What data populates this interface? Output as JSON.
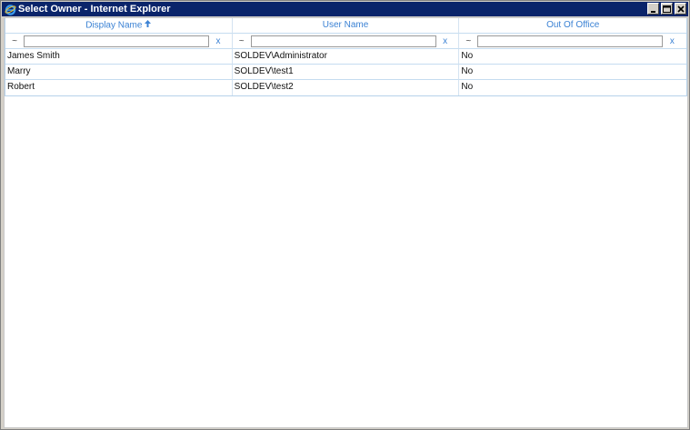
{
  "window": {
    "title": "Select Owner - Internet Explorer"
  },
  "grid": {
    "columns": [
      {
        "label": "Display Name",
        "sorted": "ascending"
      },
      {
        "label": "User Name"
      },
      {
        "label": "Out Of Office"
      }
    ],
    "filters": [
      {
        "operator": "~",
        "value": "",
        "clear": "x"
      },
      {
        "operator": "~",
        "value": "",
        "clear": "x"
      },
      {
        "operator": "~",
        "value": "",
        "clear": "x"
      }
    ],
    "rows": [
      [
        "James Smith",
        "SOLDEV\\Administrator",
        "No"
      ],
      [
        "Marry",
        "SOLDEV\\test1",
        "No"
      ],
      [
        "Robert",
        "SOLDEV\\test2",
        "No"
      ]
    ]
  },
  "colors": {
    "titlebar": "#0a246a",
    "header_text": "#3b82d4",
    "grid_border": "#c5dcf0"
  },
  "icons": {
    "app": "internet-explorer-icon",
    "sort": "sort-ascending-icon"
  }
}
